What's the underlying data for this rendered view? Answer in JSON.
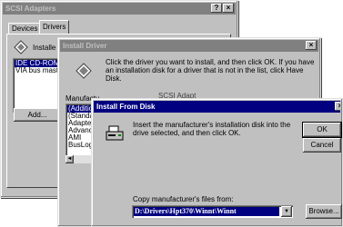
{
  "scsi_dialog": {
    "title": "SCSI Adapters",
    "tabs": [
      "Devices",
      "Drivers"
    ],
    "install_label": "Installe",
    "list_items": [
      "IDE CD-ROM",
      "VIA bus maste"
    ],
    "add_button": "Add..."
  },
  "install_driver": {
    "title": "Install Driver",
    "message": "Click the driver you want to install, and then click OK. If you have an installation disk for a driver that is not in the list, click Have Disk.",
    "manufacturer_label": "Manufactu",
    "scsi_partial": "SCSI Adapt",
    "list_items": [
      "(Additio",
      "(Standa",
      "Adapter",
      "Advanc",
      "AMI",
      "BusLog"
    ]
  },
  "install_from_disk": {
    "title": "Install From Disk",
    "message": "Insert the manufacturer's installation disk into the drive selected, and then click OK.",
    "ok_button": "OK",
    "cancel_button": "Cancel",
    "copy_label": "Copy manufacturer's files from:",
    "path_value": "D:\\Drivers\\Hpt370\\Winnt\\Winnt",
    "browse_button": "Browse..."
  },
  "icons": {
    "close": "×",
    "help": "?",
    "dropdown": "▼",
    "scroll_left": "◄"
  }
}
